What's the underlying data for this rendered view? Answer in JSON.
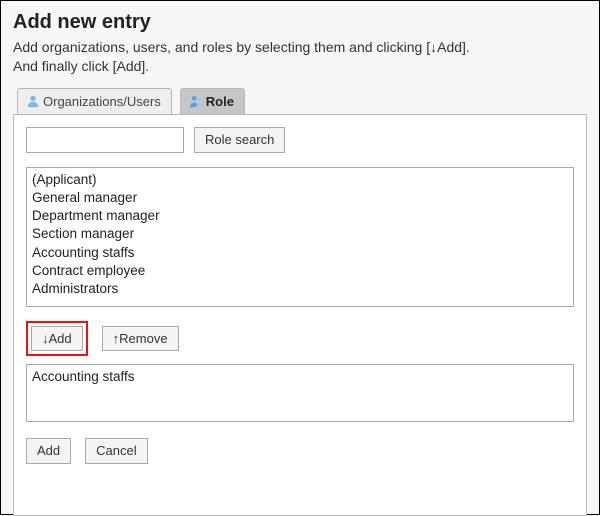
{
  "header": {
    "title": "Add new entry",
    "subtitle": "Add organizations, users, and roles by selecting them and clicking [↓Add].\nAnd finally click [Add]."
  },
  "tabs": {
    "org_users": "Organizations/Users",
    "role": "Role"
  },
  "search": {
    "value": "",
    "button": "Role search"
  },
  "candidates": [
    "(Applicant)",
    "General manager",
    "Department manager",
    "Section manager",
    "Accounting staffs",
    "Contract employee",
    "Administrators"
  ],
  "actions": {
    "add_down": "↓Add",
    "remove_up": "↑Remove"
  },
  "selected": [
    "Accounting staffs"
  ],
  "final": {
    "add": "Add",
    "cancel": "Cancel"
  }
}
